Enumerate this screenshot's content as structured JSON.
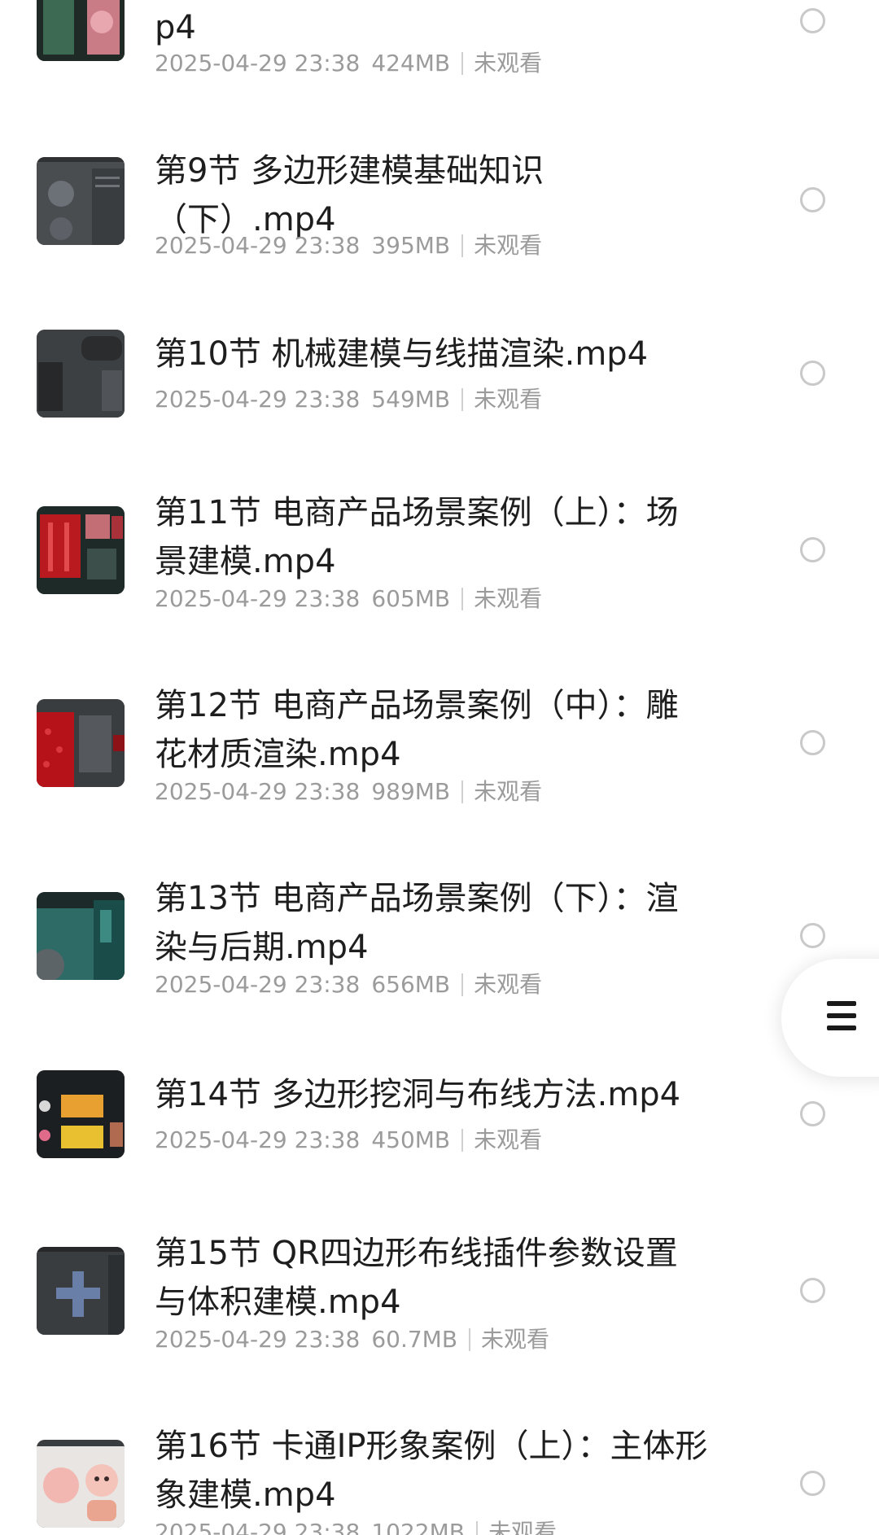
{
  "files": [
    {
      "name": "p4",
      "date": "2025-04-29 23:38",
      "size": "424MB",
      "status": "未观看",
      "thumb": "scene"
    },
    {
      "name": "第9节 多边形建模基础知识（下）.mp4",
      "date": "2025-04-29 23:38",
      "size": "395MB",
      "status": "未观看",
      "thumb": "spheres"
    },
    {
      "name": "第10节 机械建模与线描渲染.mp4",
      "date": "2025-04-29 23:38",
      "size": "549MB",
      "status": "未观看",
      "thumb": "mech"
    },
    {
      "name": "第11节 电商产品场景案例（上）：场景建模.mp4",
      "date": "2025-04-29 23:38",
      "size": "605MB",
      "status": "未观看",
      "thumb": "red-scene"
    },
    {
      "name": "第12节 电商产品场景案例（中）：雕花材质渲染.mp4",
      "date": "2025-04-29 23:38",
      "size": "989MB",
      "status": "未观看",
      "thumb": "red-texture"
    },
    {
      "name": "第13节 电商产品场景案例（下）：渲染与后期.mp4",
      "date": "2025-04-29 23:38",
      "size": "656MB",
      "status": "未观看",
      "thumb": "teal-scene"
    },
    {
      "name": "第14节 多边形挖洞与布线方法.mp4",
      "date": "2025-04-29 23:38",
      "size": "450MB",
      "status": "未观看",
      "thumb": "grid-yellow"
    },
    {
      "name": "第15节 QR四边形布线插件参数设置与体积建模.mp4",
      "date": "2025-04-29 23:38",
      "size": "60.7MB",
      "status": "未观看",
      "thumb": "plus"
    },
    {
      "name": "第16节 卡通IP形象案例（上）：主体形象建模.mp4",
      "date": "2025-04-29 23:38",
      "size": "1022MB",
      "status": "未观看",
      "thumb": "cartoon"
    }
  ],
  "floating_menu": {
    "icon": "menu-icon"
  }
}
